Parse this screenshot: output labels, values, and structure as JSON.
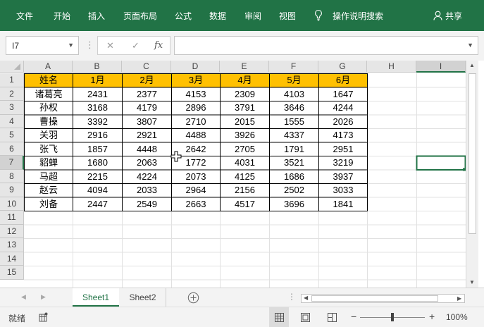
{
  "ribbon": {
    "tabs": [
      "文件",
      "开始",
      "插入",
      "页面布局",
      "公式",
      "数据",
      "审阅",
      "视图"
    ],
    "search_label": "操作说明搜索",
    "share_label": "共享",
    "bg_color": "#217346"
  },
  "formula_bar": {
    "name_box": "I7",
    "cancel_symbol": "✕",
    "enter_symbol": "✓",
    "fx_symbol": "fx",
    "formula_value": ""
  },
  "sheet": {
    "columns": [
      "A",
      "B",
      "C",
      "D",
      "E",
      "F",
      "G",
      "H",
      "I"
    ],
    "rows": [
      "1",
      "2",
      "3",
      "4",
      "5",
      "6",
      "7",
      "8",
      "9",
      "10",
      "11",
      "12",
      "13",
      "14",
      "15"
    ],
    "header_row": [
      "姓名",
      "1月",
      "2月",
      "3月",
      "4月",
      "5月",
      "6月"
    ],
    "header_fill": "#ffc000",
    "data": [
      [
        "诸葛亮",
        "2431",
        "2377",
        "4153",
        "2309",
        "4103",
        "1647"
      ],
      [
        "孙权",
        "3168",
        "4179",
        "2896",
        "3791",
        "3646",
        "4244"
      ],
      [
        "曹操",
        "3392",
        "3807",
        "2710",
        "2015",
        "1555",
        "2026"
      ],
      [
        "关羽",
        "2916",
        "2921",
        "4488",
        "3926",
        "4337",
        "4173"
      ],
      [
        "张飞",
        "1857",
        "4448",
        "2642",
        "2705",
        "1791",
        "2951"
      ],
      [
        "貂蝉",
        "1680",
        "2063",
        "1772",
        "4031",
        "3521",
        "3219"
      ],
      [
        "马超",
        "2215",
        "4224",
        "2073",
        "4125",
        "1686",
        "3937"
      ],
      [
        "赵云",
        "4094",
        "2033",
        "2964",
        "2156",
        "2502",
        "3033"
      ],
      [
        "刘备",
        "2447",
        "2549",
        "2663",
        "4517",
        "3696",
        "1841"
      ]
    ],
    "active_cell": "I7",
    "accent_color": "#217346"
  },
  "sheet_tabs": [
    "Sheet1",
    "Sheet2"
  ],
  "active_sheet": "Sheet1",
  "status_bar": {
    "ready_label": "就绪",
    "zoom": "100%",
    "zoom_minus": "−",
    "zoom_plus": "+"
  }
}
